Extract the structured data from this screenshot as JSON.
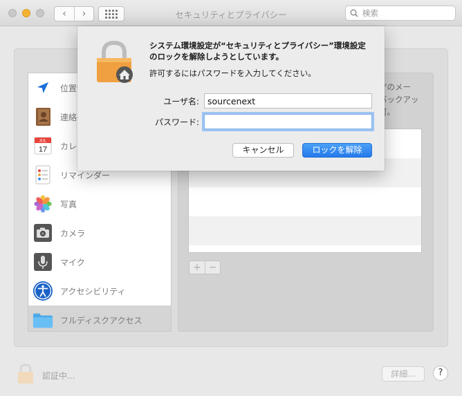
{
  "window": {
    "title": "セキュリティとプライバシー",
    "search_placeholder": "検索"
  },
  "sidebar": {
    "items": [
      {
        "label": "位置情報サービス",
        "icon": "location-arrow-icon"
      },
      {
        "label": "連絡先",
        "icon": "contacts-book-icon"
      },
      {
        "label": "カレンダー",
        "icon": "calendar-icon"
      },
      {
        "label": "リマインダー",
        "icon": "reminders-icon"
      },
      {
        "label": "写真",
        "icon": "photos-icon"
      },
      {
        "label": "カメラ",
        "icon": "camera-icon"
      },
      {
        "label": "マイク",
        "icon": "microphone-icon"
      },
      {
        "label": "アクセシビリティ",
        "icon": "accessibility-icon"
      },
      {
        "label": "フルディスクアクセス",
        "icon": "folder-icon",
        "selected": true
      }
    ],
    "calendar_month": "JUL",
    "calendar_day": "17"
  },
  "right_pane": {
    "description_lines": [
      "ザのメー",
      "バックアッ",
      "可。"
    ],
    "add_label": "+",
    "remove_label": "−"
  },
  "bottom": {
    "auth_label": "認証中...",
    "details_label": "詳細...",
    "help_label": "?"
  },
  "dialog": {
    "title_line1": "システム環境設定が“セキュリティとプライバシー”環境設定",
    "title_line2": "のロックを解除しようとしています。",
    "subtitle": "許可するにはパスワードを入力してください。",
    "username_label": "ユーザ名:",
    "username_value": "sourcenext",
    "password_label": "パスワード:",
    "password_value": "",
    "cancel_label": "キャンセル",
    "unlock_label": "ロックを解除"
  },
  "colors": {
    "accent": "#2579ea",
    "focus_ring": "#9ec4f3",
    "lock_body": "#f0a040",
    "minimize_button": "#f6b232"
  }
}
